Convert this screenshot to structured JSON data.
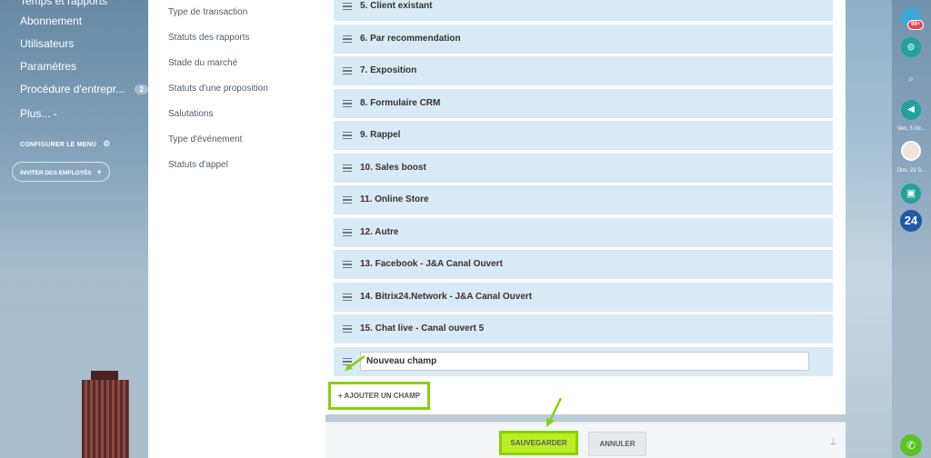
{
  "sidebar": {
    "items": [
      {
        "label": "Temps et rapports"
      },
      {
        "label": "Abonnement"
      },
      {
        "label": "Utilisateurs"
      },
      {
        "label": "Paramètres"
      },
      {
        "label": "Procédure d'entrepr...",
        "badge": "2"
      },
      {
        "label": "Plus... -"
      }
    ],
    "configure_menu": "CONFIGURER LE MENU",
    "invite_label": "INVITER DES EMPLOYÉS"
  },
  "settings_list": {
    "items": [
      "Type de transaction",
      "Statuts des rapports",
      "Stade du marché",
      "Statuts d'une proposition",
      "Salutations",
      "Type d'événement",
      "Statuts d'appel"
    ]
  },
  "fields": {
    "items": [
      "5. Client existant",
      "6. Par recommendation",
      "7. Exposition",
      "8. Formulaire CRM",
      "9. Rappel",
      "10. Sales boost",
      "11. Online Store",
      "12. Autre",
      "13. Facebook - J&A Canal Ouvert",
      "14. Bitrix24.Network - J&A Canal Ouvert",
      "15. Chat live - Canal ouvert 5"
    ],
    "new_field_value": "Nouveau champ",
    "add_field_label": "+ AJOUTER UN CHAMP"
  },
  "footer": {
    "save_label": "SAUVEGARDER",
    "cancel_label": "ANNULER"
  },
  "right_sidebar": {
    "notification_badge": "99+",
    "date_1": "Ven, 5 Oc...",
    "date_2": "Dim, 23 S...",
    "logo_text": "24"
  },
  "colors": {
    "highlight_green": "#86d10b",
    "save_button": "#bbed21",
    "field_row_bg": "#d8eaf4",
    "teal_icon": "#1fa39b",
    "logo_blue": "#1e5aa8",
    "phone_green": "#5bc324"
  }
}
